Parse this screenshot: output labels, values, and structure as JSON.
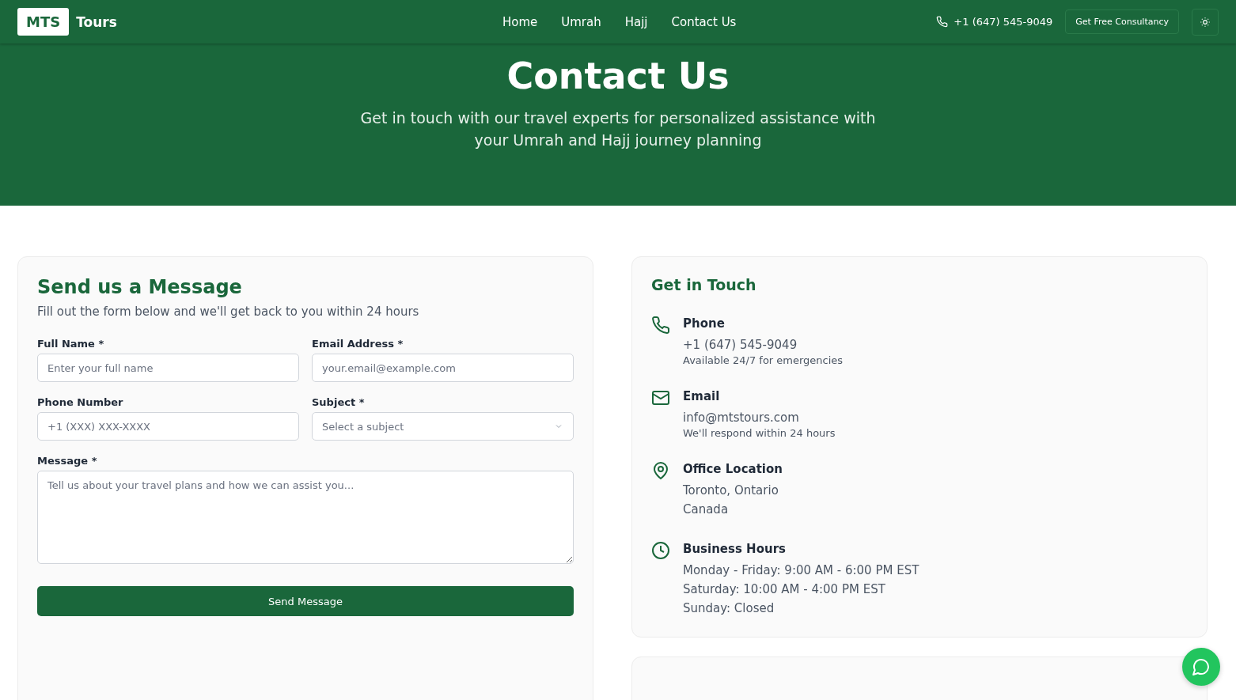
{
  "header": {
    "logo_mark": "MTS",
    "logo_text": "Tours",
    "nav": [
      "Home",
      "Umrah",
      "Hajj",
      "Contact Us"
    ],
    "phone": "+1 (647) 545-9049",
    "cta": "Get Free Consultancy"
  },
  "hero": {
    "title": "Contact Us",
    "subtitle": "Get in touch with our travel experts for personalized assistance with your Umrah and Hajj journey planning"
  },
  "form": {
    "title": "Send us a Message",
    "subtitle": "Fill out the form below and we'll get back to you within 24 hours",
    "fields": [
      {
        "kind": "input",
        "label": "Full Name *",
        "placeholder": "Enter your full name"
      },
      {
        "kind": "input",
        "label": "Email Address *",
        "placeholder": "your.email@example.com"
      },
      {
        "kind": "input",
        "label": "Phone Number",
        "placeholder": "+1 (XXX) XXX-XXXX"
      },
      {
        "kind": "select",
        "label": "Subject *",
        "placeholder": "Select a subject"
      },
      {
        "kind": "textarea",
        "label": "Message *",
        "placeholder": "Tell us about your travel plans and how we can assist you..."
      }
    ],
    "submit": "Send Message"
  },
  "contact": {
    "title": "Get in Touch",
    "items": [
      {
        "kind": "phone",
        "title": "Phone",
        "lines": [
          "+1 (647) 545-9049"
        ],
        "note": "Available 24/7 for emergencies"
      },
      {
        "kind": "email",
        "title": "Email",
        "lines": [
          "info@mtstours.com"
        ],
        "note": "We'll respond within 24 hours"
      },
      {
        "kind": "location",
        "title": "Office Location",
        "lines": [
          "Toronto, Ontario",
          "Canada"
        ]
      },
      {
        "kind": "hours",
        "title": "Business Hours",
        "lines": [
          "Monday - Friday: 9:00 AM - 6:00 PM EST",
          "Saturday: 10:00 AM - 4:00 PM EST",
          "Sunday: Closed"
        ]
      }
    ]
  }
}
